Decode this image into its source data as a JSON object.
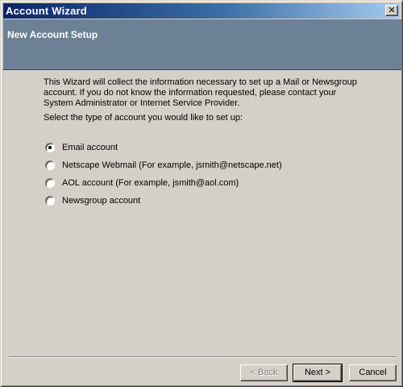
{
  "window": {
    "title": "Account Wizard",
    "close_glyph": "✕"
  },
  "header": {
    "title": "New Account Setup"
  },
  "content": {
    "intro": "This Wizard will collect the information necessary to set up a Mail or Newsgroup account. If you do not know the information requested, please contact your System Administrator or Internet Service Provider.",
    "prompt": "Select the type of account you would like to set up:"
  },
  "options": [
    {
      "label": "Email account",
      "selected": true
    },
    {
      "label": "Netscape Webmail (For example, jsmith@netscape.net)",
      "selected": false
    },
    {
      "label": "AOL account (For example, jsmith@aol.com)",
      "selected": false
    },
    {
      "label": "Newsgroup account",
      "selected": false
    }
  ],
  "buttons": {
    "back": "< Back",
    "next": "Next >",
    "cancel": "Cancel"
  }
}
